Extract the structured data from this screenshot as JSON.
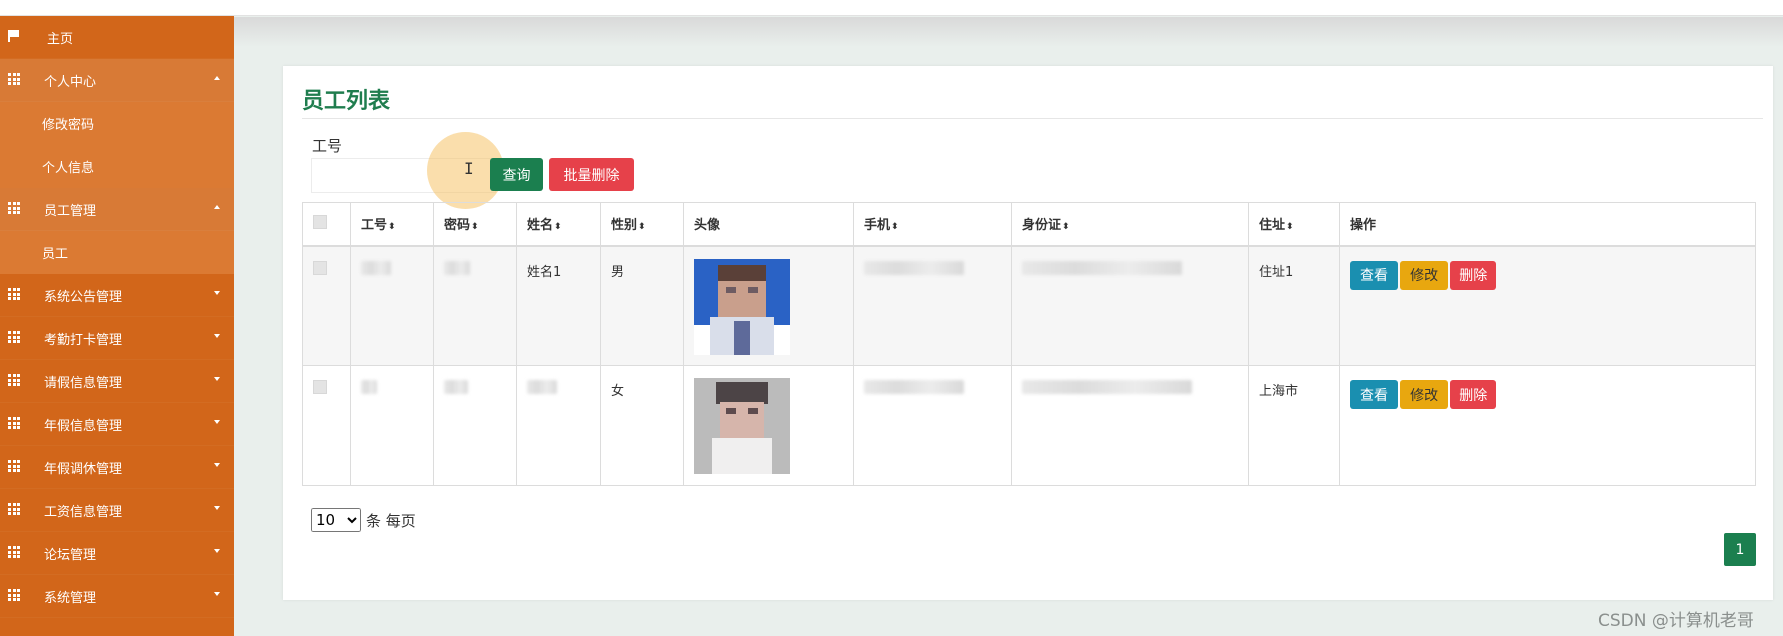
{
  "sidebar": {
    "home": "主页",
    "personal_center": {
      "label": "个人中心",
      "items": [
        "修改密码",
        "个人信息"
      ]
    },
    "employee_mgmt": {
      "label": "员工管理",
      "items": [
        "员工"
      ]
    },
    "menus": [
      "系统公告管理",
      "考勤打卡管理",
      "请假信息管理",
      "年假信息管理",
      "年假调休管理",
      "工资信息管理",
      "论坛管理",
      "系统管理"
    ]
  },
  "page": {
    "title": "员工列表",
    "search_label": "工号",
    "search_value": "",
    "query_button": "查询",
    "batch_delete_button": "批量删除"
  },
  "table": {
    "columns": [
      "工号",
      "密码",
      "姓名",
      "性别",
      "头像",
      "手机",
      "身份证",
      "住址",
      "操作"
    ],
    "rows": [
      {
        "name": "姓名1",
        "gender": "男",
        "address": "住址1"
      },
      {
        "name": "",
        "gender": "女",
        "address": "上海市"
      }
    ],
    "actions": {
      "view": "查看",
      "edit": "修改",
      "delete": "删除"
    }
  },
  "pager": {
    "page_size": "10",
    "per_page_text": "条 每页",
    "current_page": "1"
  },
  "watermark": "CSDN @计算机老哥",
  "colors": {
    "sidebar": "#d2661a",
    "accent_green": "#1b7f4f",
    "danger": "#e6414a",
    "info": "#1a8fb0",
    "warning": "#e8a70f"
  }
}
